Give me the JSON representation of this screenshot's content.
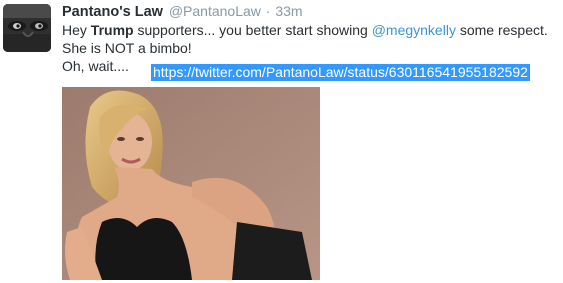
{
  "tweet": {
    "fullname": "Pantano's Law",
    "screen_name": "@PantanoLaw",
    "separator": "·",
    "time": "33m",
    "line1_prefix": "Hey ",
    "line1_bold": "Trump",
    "line1_middle": " supporters... you better start showing ",
    "line1_mention": "@megynkelly",
    "line1_suffix": " some respect.",
    "line2": "She is NOT a bimbo!",
    "line3": "Oh, wait....",
    "link": "https://twitter.com/PantanoLaw/status/630116541955182592"
  },
  "colors": {
    "link_selection": "#3399ff",
    "mention": "#3b94d9",
    "muted": "#8899a6",
    "text": "#292f33"
  }
}
